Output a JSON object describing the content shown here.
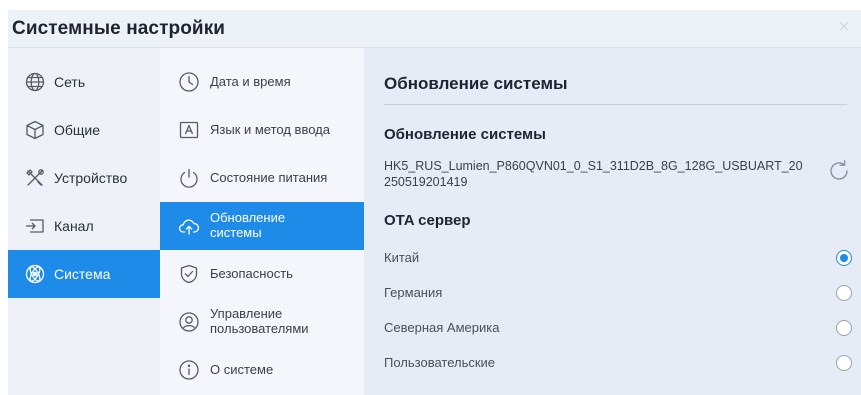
{
  "window": {
    "title": "Системные настройки",
    "close_glyph": "×"
  },
  "categories": [
    {
      "label": "Сеть",
      "icon": "globe-icon"
    },
    {
      "label": "Общие",
      "icon": "cube-icon"
    },
    {
      "label": "Устройство",
      "icon": "tools-icon"
    },
    {
      "label": "Канал",
      "icon": "input-source-icon"
    },
    {
      "label": "Система",
      "icon": "system-icon",
      "active": true
    }
  ],
  "submenu": [
    {
      "label": "Дата и время",
      "icon": "clock-icon"
    },
    {
      "label": "Язык и метод ввода",
      "icon": "keyboard-letter-icon"
    },
    {
      "label": "Состояние питания",
      "icon": "power-icon"
    },
    {
      "label_line1": "Обновление",
      "label_line2": "системы",
      "icon": "cloud-upload-icon",
      "active": true
    },
    {
      "label": "Безопасность",
      "icon": "shield-icon"
    },
    {
      "label_line1": "Управление",
      "label_line2": "пользователями",
      "icon": "user-icon"
    },
    {
      "label": "О системе",
      "icon": "info-icon"
    }
  ],
  "content": {
    "page_title": "Обновление системы",
    "update_section_title": "Обновление системы",
    "firmware_version": "HK5_RUS_Lumien_P860QVN01_0_S1_311D2B_8G_128G_USBUART_20250519201419",
    "ota_section_title": "OTA сервер",
    "ota_options": [
      {
        "label": "Китай",
        "selected": true
      },
      {
        "label": "Германия",
        "selected": false
      },
      {
        "label": "Северная Америка",
        "selected": false
      },
      {
        "label": "Пользовательские",
        "selected": false
      }
    ]
  },
  "colors": {
    "accent": "#1f8be8",
    "window_bg": "#e6ecf6",
    "submenu_bg": "#f4f6fb"
  }
}
